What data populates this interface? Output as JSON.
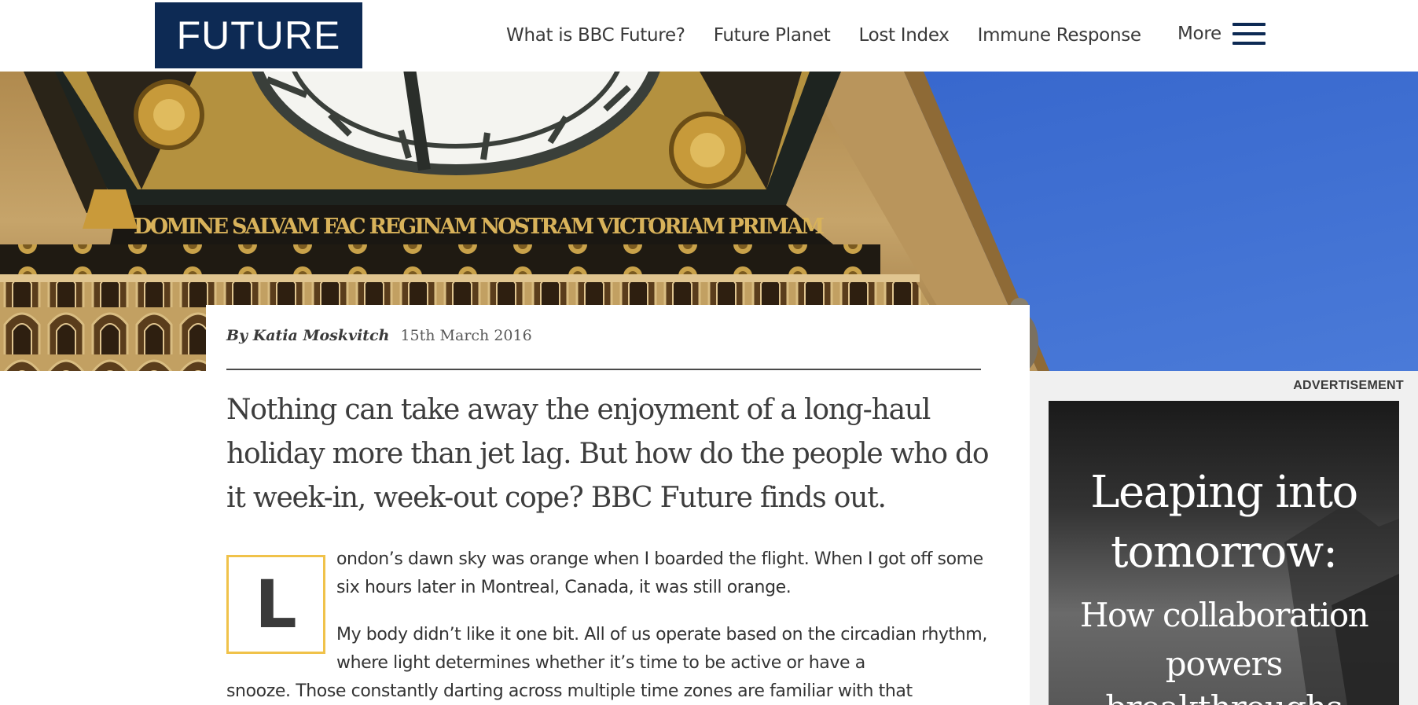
{
  "header": {
    "logo": "FUTURE",
    "nav": [
      "What is BBC Future?",
      "Future Planet",
      "Lost Index",
      "Immune Response"
    ],
    "more_label": "More",
    "menu_icon": "hamburger-menu-icon"
  },
  "hero": {
    "image": "Big Ben clock tower face against blue sky",
    "inscription": "DOMINE SALVAM FAC REGINAM NOSTRAM VICTORIAM PRIMAM"
  },
  "article": {
    "author": "By Katia Moskvitch",
    "date": "15th March 2016",
    "standfirst": "Nothing can take away the enjoyment of a long-haul holiday more than jet lag. But how do the people who do it week-in, week-out cope? BBC Future finds out.",
    "dropcap": "L",
    "p1": "ondon’s dawn sky was orange when I boarded the flight. When I got off some six hours later in Montreal, Canada, it was still orange.",
    "p2_start": "My body didn’t like it one bit. All of us operate based on the circadian rhythm, where light determines whether it’s time to be active or have a",
    "p2_cont": "snooze. Those constantly darting across multiple time zones are familiar with that"
  },
  "sidebar": {
    "ad_label": "ADVERTISEMENT",
    "ad_lines": [
      "Leaping into",
      "tomorrow:",
      "How collaboration",
      "powers",
      "breakthroughs"
    ]
  },
  "colors": {
    "brand": "#0d2a54",
    "dropcap_border": "#f0c24a",
    "sky": "#3f6ed0"
  }
}
